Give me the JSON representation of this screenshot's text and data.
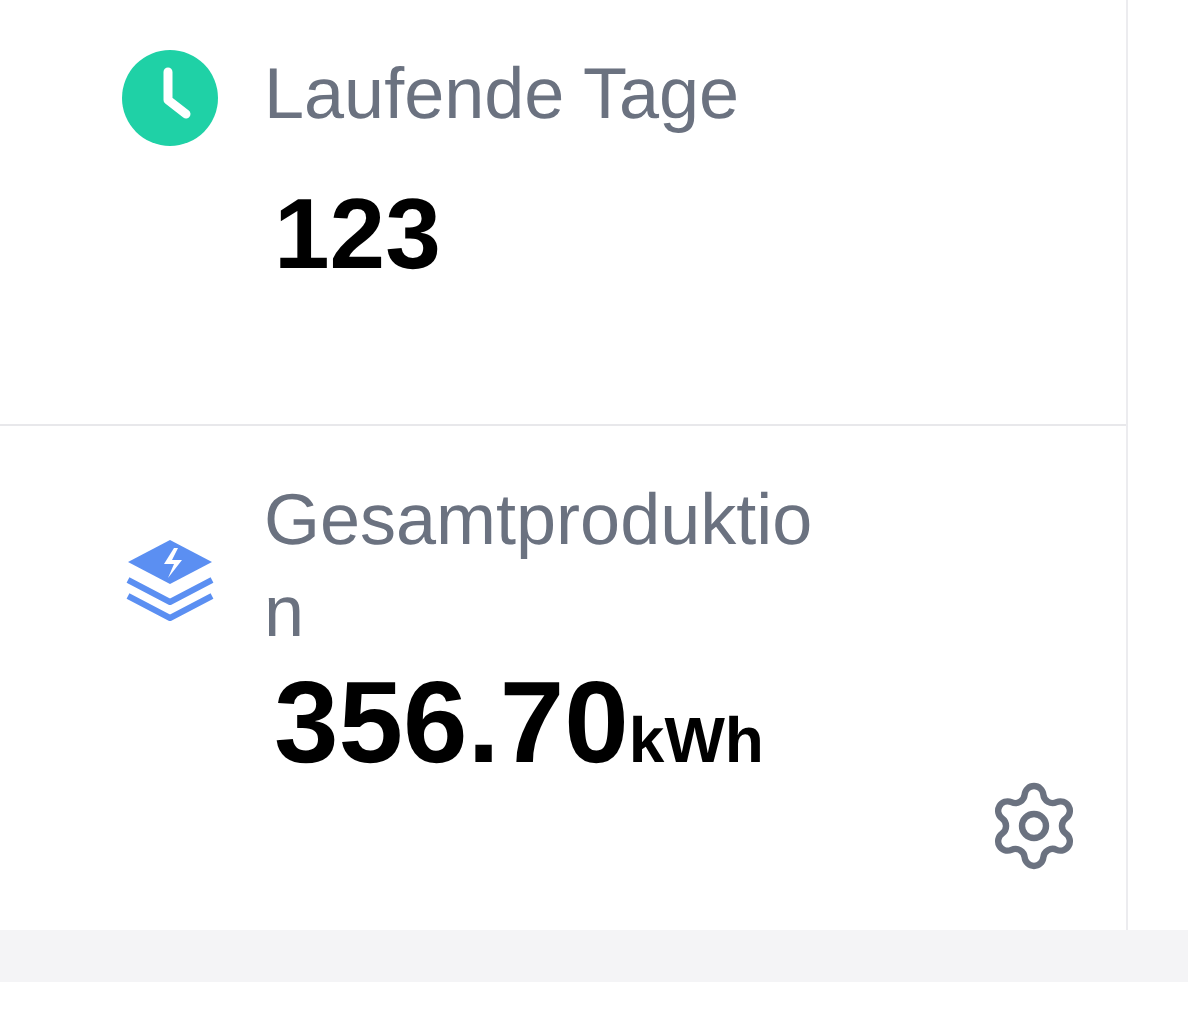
{
  "stats": [
    {
      "kind": "days",
      "label": "Laufende Tage",
      "value": "123"
    },
    {
      "kind": "energy",
      "label": "Gesamtproduktion",
      "value": "356.70",
      "unit": "kWh",
      "settings": true
    }
  ]
}
